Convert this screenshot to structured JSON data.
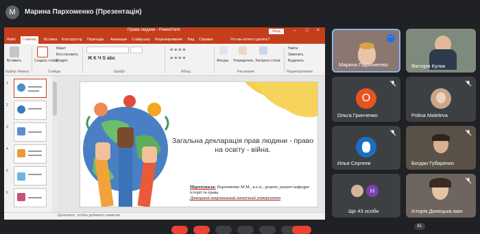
{
  "presenter": {
    "initial": "М",
    "title": "Марина Пархоменко (Презентація)"
  },
  "ppt": {
    "titlebar": {
      "title": "Права людини - PowerPoint",
      "signin": "Вход"
    },
    "menu": [
      "Файл",
      "Главная",
      "Вставка",
      "Конструктор",
      "Переходы",
      "Анимация",
      "Слайд-шоу",
      "Рецензирование",
      "Вид",
      "Справка",
      "Что вы хотите сделать?"
    ],
    "ribbon": {
      "paste": "Вставить",
      "clipboard": "Буфер обмена",
      "new_slide": "Создать слайд",
      "layout": "Макет",
      "reset": "Восстановить",
      "section": "Раздел",
      "slides": "Слайды",
      "font": "Шрифт",
      "paragraph": "Абзац",
      "shapes": "Фигуры",
      "arrange": "Упорядочить",
      "styles": "Экспресс-стили",
      "drawing": "Рисование",
      "find": "Найти",
      "replace": "Заменить",
      "select": "Выделить",
      "editing": "Редактирование"
    },
    "thumb_numbers": [
      "1",
      "2",
      "3",
      "4",
      "5",
      "6"
    ],
    "slide": {
      "main_text": "Загальна декларація прав людини - право на освіту - війна.",
      "credits_label": "Підготувала:",
      "credits_name": " Пархоменко М.М., к.е.н., доцент, доцент кафедри історії та права",
      "credits_uni": "Донецький національний технічний університет"
    },
    "notes": "Щелкните, чтобы добавить заметки"
  },
  "participants": [
    {
      "name": "Марина Пархоменко"
    },
    {
      "name": "Вікторія Кулик"
    },
    {
      "name": "Ольга Гринченко",
      "initial": "О",
      "color": "#e8541f"
    },
    {
      "name": "Polina Maleleva"
    },
    {
      "name": "Илья Сергеев"
    },
    {
      "name": "Богдан Губаренко"
    },
    {
      "name": "Ще 43 особи",
      "initial": "Н"
    },
    {
      "name": "Історія Донецька ман"
    }
  ],
  "participant_count": "61"
}
